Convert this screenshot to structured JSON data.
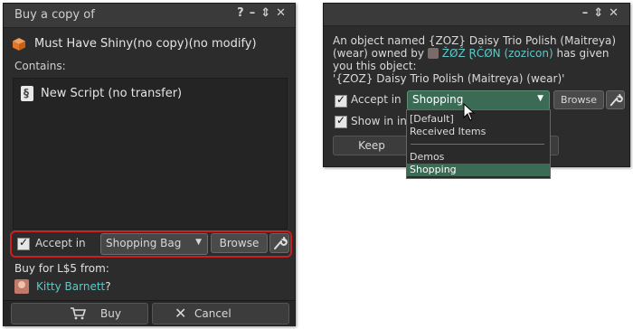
{
  "buy_dialog": {
    "title": "Buy a copy of",
    "controls": {
      "help": "?",
      "minimize": "–",
      "dock": "⇕",
      "close": "✕"
    },
    "object_name": "Must Have Shiny(no copy)(no modify)",
    "contains_label": "Contains:",
    "contents": [
      {
        "label": "New Script (no transfer)",
        "icon": "script-icon"
      }
    ],
    "accept_in_label": "Accept in",
    "accept_in_checked": true,
    "folder_value": "Shopping Bag",
    "browse_label": "Browse",
    "buy_for_label": "Buy for L$5 from:",
    "seller_name": "Kitty Barnett",
    "seller_suffix": "?",
    "buy_button": "Buy",
    "cancel_button": "Cancel"
  },
  "give_dialog": {
    "controls": {
      "minimize": "–",
      "dock": "⇕",
      "close": "✕"
    },
    "message_line1": "An object named {ZOZ} Daisy Trio Polish (Maitreya)",
    "message_line2_pre": "(wear) owned by",
    "owner_name": "ŽØŽ ⱤČØN (zozicon)",
    "message_line2_post": "has given",
    "message_line3": "you this object:",
    "message_line4": "'{ZOZ} Daisy Trio Polish (Maitreya) (wear)'",
    "accept_in_label": "Accept in",
    "accept_in_checked": true,
    "folder_value": "Shopping",
    "browse_label": "Browse",
    "show_in_inventory_label": "Show in inve",
    "show_in_inventory_checked": true,
    "keep_button": "Keep",
    "dropdown_options": [
      "[Default]",
      "Received Items",
      "Demos",
      "Shopping"
    ],
    "dropdown_selected": "Shopping"
  },
  "colors": {
    "accent_link": "#5ec8c8",
    "highlight_border": "#cc1f1f",
    "selection": "#3b6a55"
  }
}
